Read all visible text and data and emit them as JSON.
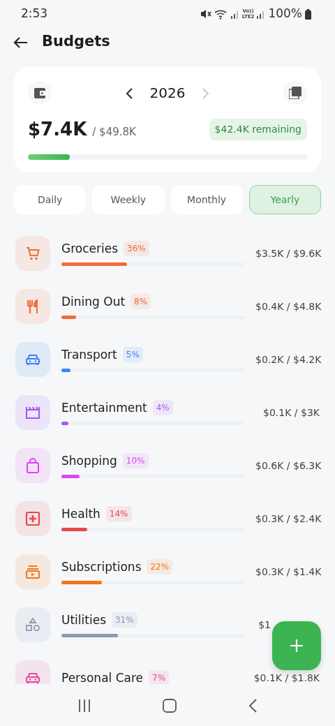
{
  "status_bar": {
    "time": "2:53",
    "network_top": "Vo))",
    "network_bottom": "LTE2",
    "battery": "100%"
  },
  "header": {
    "title": "Budgets"
  },
  "summary": {
    "year": "2026",
    "spent": "$7.4K",
    "total": "/ $49.8K",
    "remaining": "$42.4K remaining",
    "level": 0.15
  },
  "tabs": [
    {
      "label": "Daily",
      "selected": false
    },
    {
      "label": "Weekly",
      "selected": false
    },
    {
      "label": "Monthly",
      "selected": false
    },
    {
      "label": "Yearly",
      "selected": true
    }
  ],
  "categories": [
    {
      "kind": "cart",
      "name": "Groceries",
      "percent": "36%",
      "amount": "$3.5K / $9.6K",
      "level": 0.36,
      "color": "#f26b3a"
    },
    {
      "kind": "cutlery",
      "name": "Dining Out",
      "percent": "8%",
      "amount": "$0.4K / $4.8K",
      "level": 0.08,
      "color": "#f26b3a"
    },
    {
      "kind": "car",
      "name": "Transport",
      "percent": "5%",
      "amount": "$0.2K / $4.2K",
      "level": 0.05,
      "color": "#3b82f6"
    },
    {
      "kind": "clapper",
      "name": "Entertainment",
      "percent": "4%",
      "amount": "$0.1K / $3K",
      "level": 0.04,
      "color": "#a855f7"
    },
    {
      "kind": "bag",
      "name": "Shopping",
      "percent": "10%",
      "amount": "$0.6K / $6.3K",
      "level": 0.1,
      "color": "#d946ef"
    },
    {
      "kind": "medical",
      "name": "Health",
      "percent": "14%",
      "amount": "$0.3K / $2.4K",
      "level": 0.14,
      "color": "#e5484d"
    },
    {
      "kind": "media",
      "name": "Subscriptions",
      "percent": "22%",
      "amount": "$0.3K / $1.4K",
      "level": 0.22,
      "color": "#f97316"
    },
    {
      "kind": "shapes",
      "name": "Utilities",
      "percent": "31%",
      "amount": "$1",
      "level": 0.31,
      "color": "#8a9ab3"
    },
    {
      "kind": "car",
      "name": "Personal Care",
      "percent": "7%",
      "amount": "$0.1K / $1.8K",
      "color": "#ec4899"
    }
  ]
}
